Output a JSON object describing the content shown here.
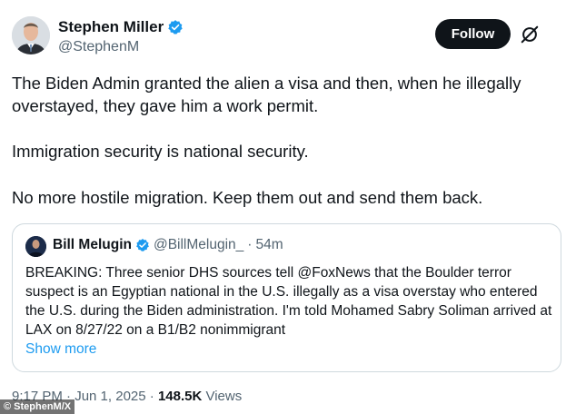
{
  "author": {
    "name": "Stephen Miller",
    "handle": "@StephenM"
  },
  "follow_label": "Follow",
  "tweet": {
    "paragraphs": [
      "The Biden Admin granted the alien a visa and then, when he illegally overstayed, they gave him a work permit.",
      "Immigration security is national security.",
      "No more hostile migration. Keep them out and send them back."
    ]
  },
  "quote": {
    "name": "Bill Melugin",
    "handle": "@BillMelugin_",
    "separator": "·",
    "time": "54m",
    "text": "BREAKING: Three senior DHS sources tell @FoxNews that the Boulder terror suspect is an Egyptian national in the U.S. illegally as a visa overstay who entered the U.S. during the Biden administration. I'm told Mohamed Sabry Soliman arrived at LAX on 8/27/22 on a B1/B2 nonimmigrant",
    "show_more": "Show more"
  },
  "footer": {
    "timestamp": "9:17 PM · Jun 1, 2025",
    "separator": "·",
    "views_count": "148.5K",
    "views_label": "Views"
  },
  "credit": "© StephenM/X",
  "icons": {
    "verified": "verified-badge-icon",
    "grok": "grok-icon"
  },
  "colors": {
    "verified_blue": "#1d9bf0",
    "follow_bg": "#0f1419",
    "link": "#1d9bf0",
    "secondary_text": "#536471",
    "border": "#cfd9de"
  }
}
